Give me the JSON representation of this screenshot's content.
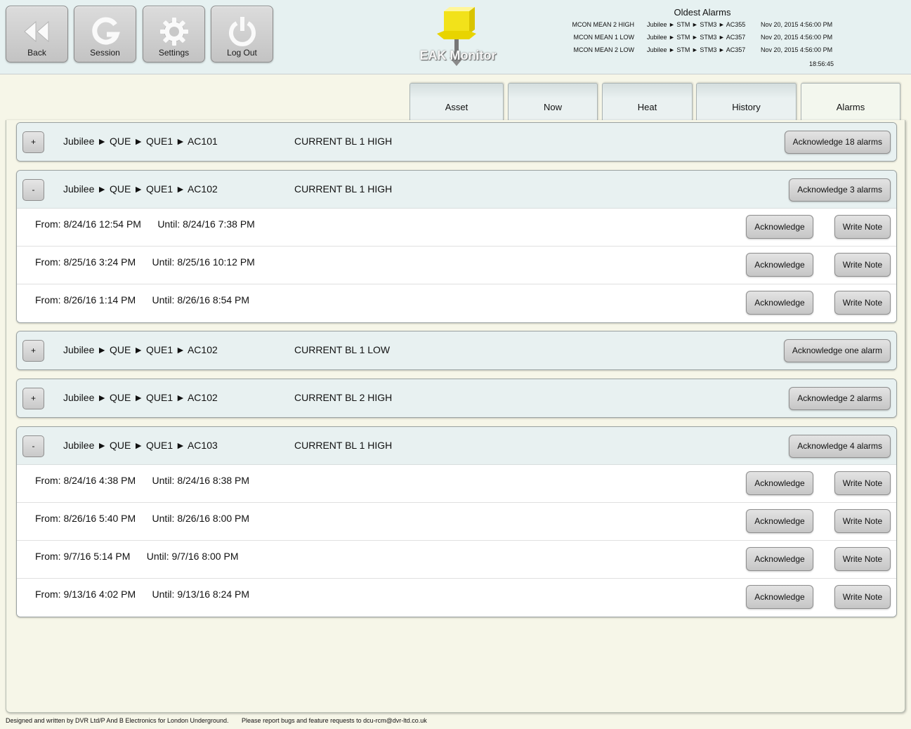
{
  "nav": {
    "back": "Back",
    "session": "Session",
    "settings": "Settings",
    "logout": "Log Out"
  },
  "logo": {
    "text": "EAK Monitor"
  },
  "oldest_alarms": {
    "title": "Oldest Alarms",
    "rows": [
      {
        "type": "MCON MEAN 2 HIGH",
        "path": "Jubilee ► STM ► STM3 ► AC355",
        "date": "Nov 20, 2015 4:56:00 PM"
      },
      {
        "type": "MCON MEAN 1 LOW",
        "path": "Jubilee ► STM ► STM3 ► AC357",
        "date": "Nov 20, 2015 4:56:00 PM"
      },
      {
        "type": "MCON MEAN 2 LOW",
        "path": "Jubilee ► STM ► STM3 ► AC357",
        "date": "Nov 20, 2015 4:56:00 PM"
      }
    ],
    "clock": "18:56:45"
  },
  "tabs": [
    {
      "label": "Asset"
    },
    {
      "label": "Now"
    },
    {
      "label": "Heat"
    },
    {
      "label": "History"
    },
    {
      "label": "Alarms",
      "active": true
    }
  ],
  "row_buttons": {
    "acknowledge": "Acknowledge",
    "write_note": "Write Note"
  },
  "groups": [
    {
      "toggle": "+",
      "path": "Jubilee ► QUE ► QUE1 ► AC101",
      "alarm": "CURRENT BL 1 HIGH",
      "ack_label": "Acknowledge 18 alarms",
      "rows": []
    },
    {
      "toggle": "-",
      "path": "Jubilee ► QUE ► QUE1 ► AC102",
      "alarm": "CURRENT BL 1 HIGH",
      "ack_label": "Acknowledge 3 alarms",
      "rows": [
        {
          "from": "From: 8/24/16 12:54 PM",
          "until": "Until: 8/24/16 7:38 PM"
        },
        {
          "from": "From: 8/25/16 3:24 PM",
          "until": "Until: 8/25/16 10:12 PM"
        },
        {
          "from": "From: 8/26/16 1:14 PM",
          "until": "Until: 8/26/16 8:54 PM"
        }
      ]
    },
    {
      "toggle": "+",
      "path": "Jubilee ► QUE ► QUE1 ► AC102",
      "alarm": "CURRENT BL 1 LOW",
      "ack_label": "Acknowledge one alarm",
      "rows": []
    },
    {
      "toggle": "+",
      "path": "Jubilee ► QUE ► QUE1 ► AC102",
      "alarm": "CURRENT BL 2 HIGH",
      "ack_label": "Acknowledge 2 alarms",
      "rows": []
    },
    {
      "toggle": "-",
      "path": "Jubilee ► QUE ► QUE1 ► AC103",
      "alarm": "CURRENT BL 1 HIGH",
      "ack_label": "Acknowledge 4 alarms",
      "rows": [
        {
          "from": "From: 8/24/16 4:38 PM",
          "until": "Until: 8/24/16 8:38 PM"
        },
        {
          "from": "From: 8/26/16 5:40 PM",
          "until": "Until: 8/26/16 8:00 PM"
        },
        {
          "from": "From: 9/7/16 5:14 PM",
          "until": "Until: 9/7/16 8:00 PM"
        },
        {
          "from": "From: 9/13/16 4:02 PM",
          "until": "Until: 9/13/16 8:24 PM"
        }
      ]
    }
  ],
  "footer": {
    "credit": "Designed and written by DVR Ltd/P And B Electronics for London Underground.",
    "report": "Please report bugs and feature requests to dcu-rcm@dvr-ltd.co.uk"
  }
}
